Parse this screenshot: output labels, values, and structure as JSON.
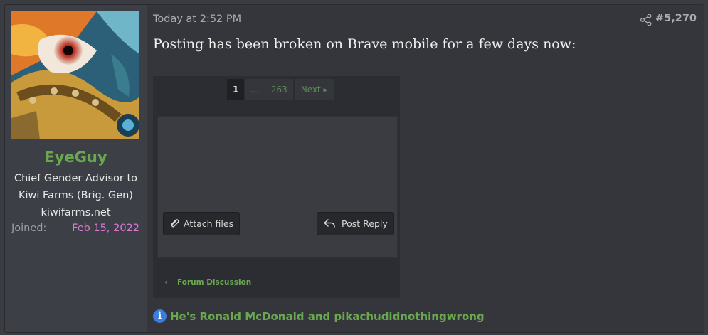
{
  "user": {
    "name": "EyeGuy",
    "title_line1": "Chief Gender Advisor to",
    "title_line2": "Kiwi Farms (Brig. Gen)",
    "title_line3": "kiwifarms.net",
    "joined_label": "Joined:",
    "joined_date": "Feb 15, 2022"
  },
  "post": {
    "timestamp": "Today at 2:52 PM",
    "number": "#5,270",
    "message": "Posting has been broken on Brave mobile for a few days now:",
    "signature": "He's Ronald McDonald and pikachudidnothingwrong"
  },
  "embedded_screenshot": {
    "pager": {
      "current": "1",
      "ellipsis": "...",
      "last": "263",
      "next": "Next ▸"
    },
    "attach_label": "Attach files",
    "reply_label": "Post Reply",
    "forum_link": "Forum Discussion"
  },
  "colors": {
    "accent_green": "#6aa84f",
    "date_pink": "#d97bd3",
    "info_blue": "#3b7dd8"
  },
  "icons": [
    "share-icon",
    "paperclip-icon",
    "reply-icon",
    "chevron-left-icon",
    "info-icon"
  ]
}
